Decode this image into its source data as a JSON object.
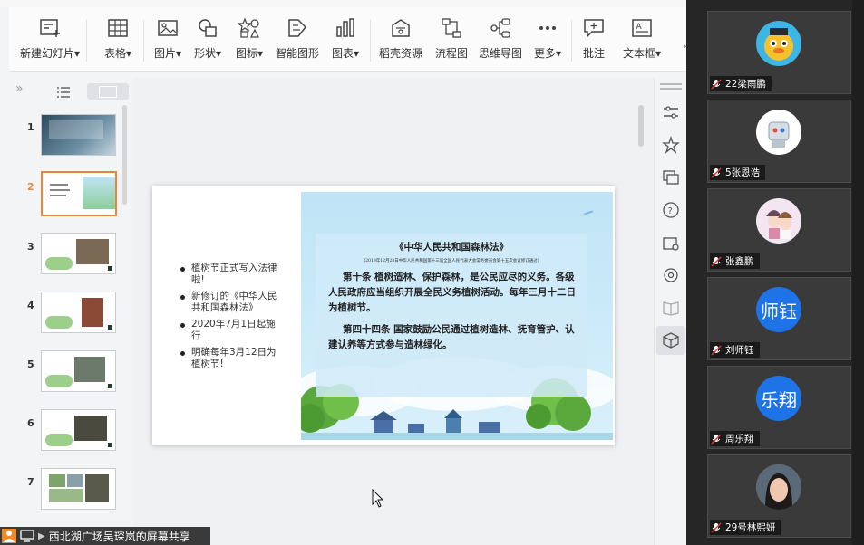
{
  "toolbar": {
    "items": [
      {
        "label": "新建幻灯片",
        "has_dropdown": true,
        "icon": "new-slide-icon"
      },
      {
        "label": "表格",
        "has_dropdown": true,
        "icon": "table-icon"
      },
      {
        "label": "图片",
        "has_dropdown": true,
        "icon": "picture-icon"
      },
      {
        "label": "形状",
        "has_dropdown": true,
        "icon": "shape-icon"
      },
      {
        "label": "图标",
        "has_dropdown": true,
        "icon": "icon-library-icon"
      },
      {
        "label": "智能图形",
        "has_dropdown": false,
        "icon": "smart-graphic-icon"
      },
      {
        "label": "图表",
        "has_dropdown": true,
        "icon": "chart-icon"
      },
      {
        "label": "稻壳资源",
        "has_dropdown": false,
        "icon": "resource-icon"
      },
      {
        "label": "流程图",
        "has_dropdown": false,
        "icon": "flowchart-icon"
      },
      {
        "label": "思维导图",
        "has_dropdown": false,
        "icon": "mindmap-icon"
      },
      {
        "label": "更多",
        "has_dropdown": true,
        "icon": "more-icon"
      },
      {
        "label": "批注",
        "has_dropdown": false,
        "icon": "comment-icon"
      },
      {
        "label": "文本框",
        "has_dropdown": true,
        "icon": "textbox-icon"
      }
    ],
    "dropdown_glyph": "▾"
  },
  "thumbnails": {
    "items": [
      {
        "num": "1"
      },
      {
        "num": "2",
        "selected": true
      },
      {
        "num": "3"
      },
      {
        "num": "4"
      },
      {
        "num": "5"
      },
      {
        "num": "6"
      },
      {
        "num": "7"
      }
    ]
  },
  "slide": {
    "bullets": [
      "植树节正式写入法律啦!",
      "新修订的《中华人民共和国森林法》",
      "2020年7月1日起施行",
      "明确每年3月12日为植树节!"
    ],
    "law": {
      "title": "《中华人民共和国森林法》",
      "subtitle": "（2019年12月28日中华人民共和国第十三届全国人民代表大会常务委员会第十五次会议修订通过）",
      "para1": "第十条 植树造林、保护森林，是公民应尽的义务。各级人民政府应当组织开展全民义务植树活动。每年三月十二日为植树节。",
      "para2": "第四十四条 国家鼓励公民通过植树造林、抚育管护、认建认养等方式参与造林绿化。"
    }
  },
  "share_bar": {
    "label": "西北湖广场吴琛岚的屏幕共享"
  },
  "participants": [
    {
      "name": "22梁雨鹏",
      "avatar": "cartoon-duck-avatar"
    },
    {
      "name": "5张恩浩",
      "avatar": "robot-avatar"
    },
    {
      "name": "张鑫鹏",
      "avatar": "anime-girl-avatar"
    },
    {
      "name": "刘师钰",
      "avatar_text": "师钰",
      "avatar_color": "#1e74e6"
    },
    {
      "name": "周乐翔",
      "avatar_text": "乐翔",
      "avatar_color": "#1e74e6"
    },
    {
      "name": "29号林熙妍",
      "avatar": "photo-avatar"
    }
  ],
  "colors": {
    "accent": "#e8863b",
    "mic_red": "#e03b3b",
    "avatar_blue": "#1e74e6"
  }
}
